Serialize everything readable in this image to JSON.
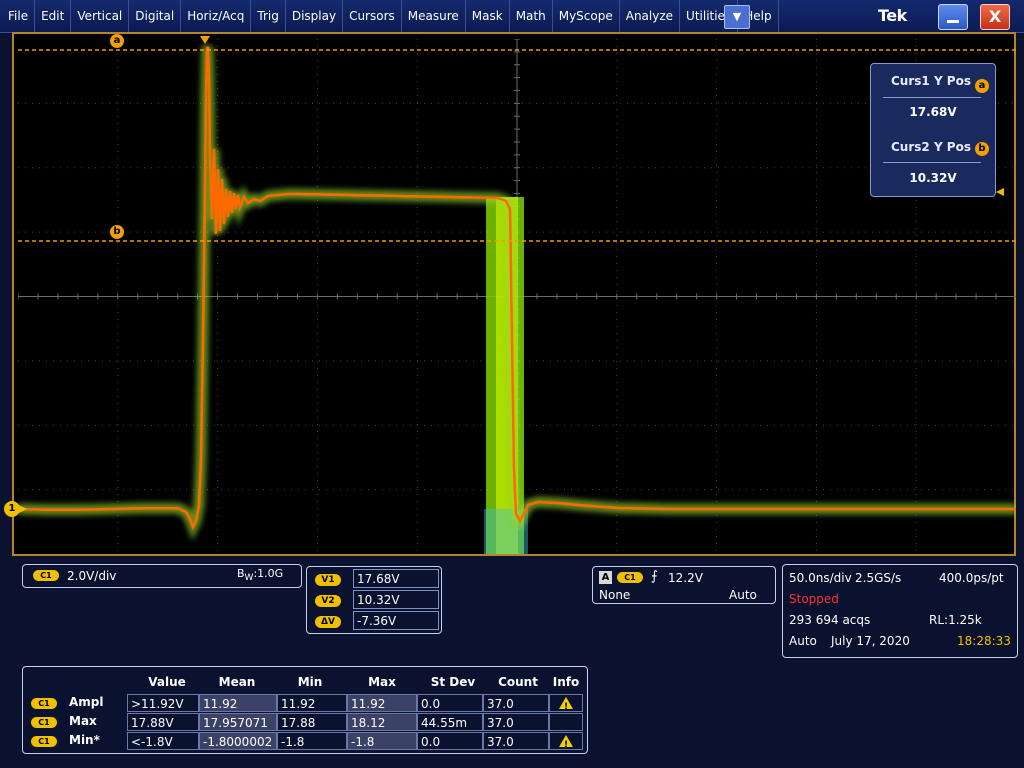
{
  "menu": {
    "items": [
      "File",
      "Edit",
      "Vertical",
      "Digital",
      "Horiz/Acq",
      "Trig",
      "Display",
      "Cursors",
      "Measure",
      "Mask",
      "Math",
      "MyScope",
      "Analyze",
      "Utilities",
      "Help"
    ],
    "dropdown_glyph": "▼",
    "brand": "Tek",
    "close_glyph": "X"
  },
  "graticule": {
    "cursor_a_label": "a",
    "cursor_b_label": "b",
    "channel_marker": "1"
  },
  "cursor_readout": {
    "curs1_title": "Curs1 Y Pos",
    "curs1_badge": "a",
    "curs1_value": "17.68V",
    "curs2_title": "Curs2 Y Pos",
    "curs2_badge": "b",
    "curs2_value": "10.32V"
  },
  "channel": {
    "badge": "C1",
    "scale": "2.0V/div",
    "bw_label": "B",
    "bw_sub": "W",
    "bw_value": ":1.0G"
  },
  "cursor_values": [
    {
      "badge": "V1",
      "value": "17.68V"
    },
    {
      "badge": "V2",
      "value": "10.32V"
    },
    {
      "badge": "ΔV",
      "value": "-7.36V"
    }
  ],
  "trigger": {
    "type_badge": "A",
    "source_badge": "C1",
    "slope_glyph": "⨍",
    "level": "12.2V",
    "coupling": "None",
    "mode": "Auto"
  },
  "acquisition": {
    "timebase": "50.0ns/div",
    "sample_rate": "2.5GS/s",
    "resolution": "400.0ps/pt",
    "state": "Stopped",
    "acqs": "293 694 acqs",
    "record_length": "RL:1.25k",
    "run_mode": "Auto",
    "date": "July 17, 2020",
    "time": "18:28:33"
  },
  "measurements": {
    "headers": [
      "Value",
      "Mean",
      "Min",
      "Max",
      "St Dev",
      "Count",
      "Info"
    ],
    "rows": [
      {
        "badge": "C1",
        "label": "Ampl",
        "value": ">11.92V",
        "mean": "11.92",
        "min": "11.92",
        "max": "11.92",
        "stdev": "0.0",
        "count": "37.0",
        "warning": true
      },
      {
        "badge": "C1",
        "label": "Max",
        "value": "17.88V",
        "mean": "17.957071",
        "min": "17.88",
        "max": "18.12",
        "stdev": "44.55m",
        "count": "37.0",
        "warning": false
      },
      {
        "badge": "C1",
        "label": "Min*",
        "value": "<-1.8V",
        "mean": "-1.8000002",
        "min": "-1.8",
        "max": "-1.8",
        "stdev": "0.0",
        "count": "37.0",
        "warning": true
      }
    ]
  },
  "colors": {
    "trace_core": "#ff6a00",
    "trace_glow": "#f0e000",
    "persistence": "#7fd000",
    "cursor": "#f0a000",
    "frame": "#b5832e",
    "background": "#0b1230"
  }
}
